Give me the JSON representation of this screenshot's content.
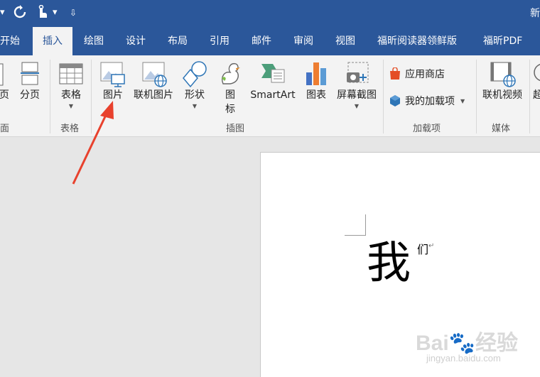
{
  "title_bar": {
    "title": "新",
    "redo_icon": "redo-icon",
    "touch_icon": "touch-mode-icon",
    "customize_symbol": "⇩"
  },
  "tabs": [
    {
      "label": "开始"
    },
    {
      "label": "插入"
    },
    {
      "label": "绘图"
    },
    {
      "label": "设计"
    },
    {
      "label": "布局"
    },
    {
      "label": "引用"
    },
    {
      "label": "邮件"
    },
    {
      "label": "审阅"
    },
    {
      "label": "视图"
    },
    {
      "label": "福昕阅读器领鲜版"
    },
    {
      "label": "福昕PDF"
    }
  ],
  "ribbon": {
    "pages_group": {
      "label": "页",
      "page_partial": "页",
      "page_break": "分页",
      "group_label_partial": "面"
    },
    "table_group": {
      "table_label": "表格",
      "group_label": "表格"
    },
    "illustrations": {
      "picture": "图片",
      "online_picture": "联机图片",
      "shapes": "形状",
      "icons_line1": "图",
      "icons_line2": "标",
      "smartart": "SmartArt",
      "chart": "图表",
      "screenshot": "屏幕截图",
      "group_label": "插图"
    },
    "addins": {
      "store": "应用商店",
      "my_addins": "我的加载项",
      "group_label": "加载项"
    },
    "media": {
      "online_video": "联机视频",
      "group_label": "媒体"
    },
    "links_partial": "超"
  },
  "document": {
    "big_char": "我",
    "small_char": "们",
    "para_mark": "↵"
  },
  "watermark": {
    "main": "Bai🐾经验",
    "sub": "jingyan.baidu.com"
  },
  "colors": {
    "ribbon_blue": "#2b579a",
    "arrow_red": "#e8412d"
  }
}
